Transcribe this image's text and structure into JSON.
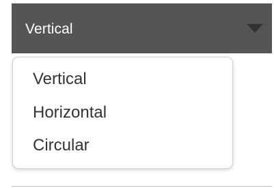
{
  "select": {
    "current_value": "Vertical",
    "icon": "caret-down-icon",
    "options": [
      {
        "label": "Vertical"
      },
      {
        "label": "Horizontal"
      },
      {
        "label": "Circular"
      }
    ]
  },
  "colors": {
    "select_background": "#555555",
    "select_text": "#ffffff",
    "caret": "#333333",
    "menu_text": "#333333",
    "menu_border": "#cfcfcf",
    "divider": "#bdbdbd"
  }
}
